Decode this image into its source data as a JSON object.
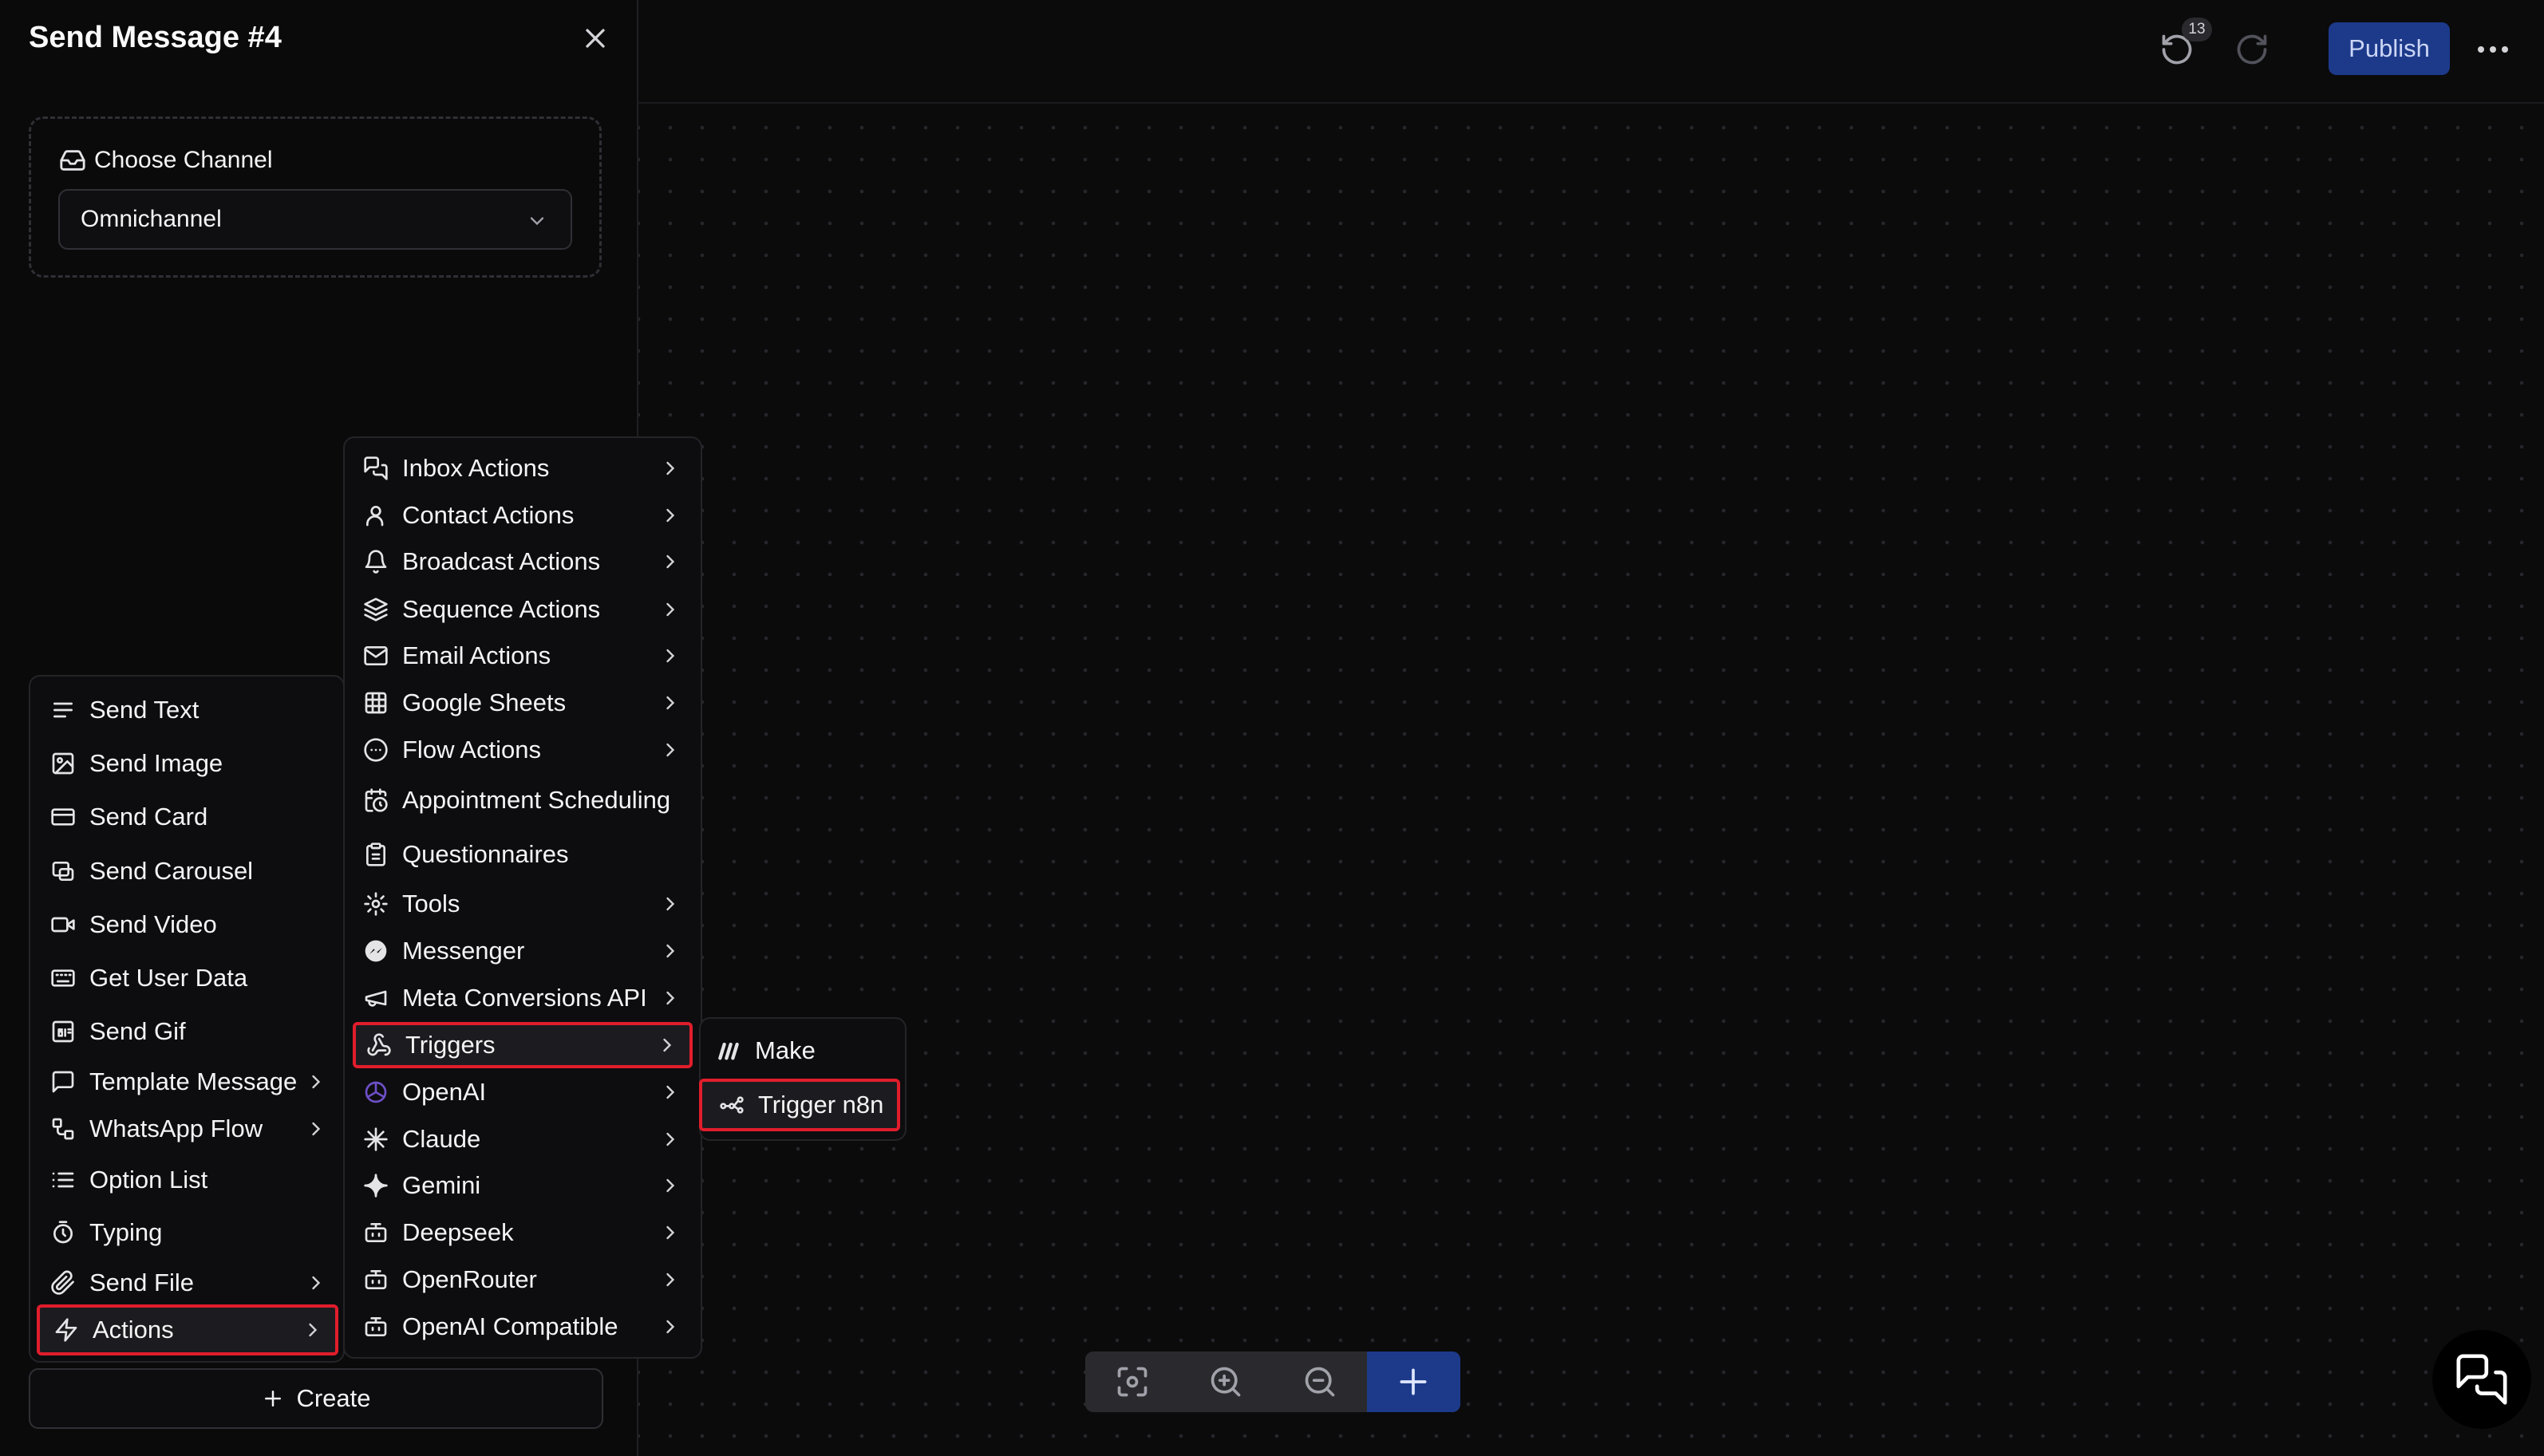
{
  "panel": {
    "title": "Send Message #4",
    "channel_label": "Choose Channel",
    "channel_value": "Omnichannel",
    "create_label": "Create"
  },
  "toolbar": {
    "undo_count": "13",
    "publish_label": "Publish"
  },
  "main_menu": [
    {
      "label": "Send Text",
      "icon": "text-lines-icon",
      "submenu": false
    },
    {
      "label": "Send Image",
      "icon": "image-icon",
      "submenu": false
    },
    {
      "label": "Send Card",
      "icon": "card-icon",
      "submenu": false
    },
    {
      "label": "Send Carousel",
      "icon": "carousel-icon",
      "submenu": false
    },
    {
      "label": "Send Video",
      "icon": "video-icon",
      "submenu": false
    },
    {
      "label": "Get User Data",
      "icon": "keyboard-icon",
      "submenu": false
    },
    {
      "label": "Send Gif",
      "icon": "gif-icon",
      "submenu": false
    },
    {
      "label": "Template Message",
      "icon": "message-square-icon",
      "submenu": true
    },
    {
      "label": "WhatsApp Flow",
      "icon": "flow-icon",
      "submenu": true
    },
    {
      "label": "Option List",
      "icon": "list-icon",
      "submenu": false
    },
    {
      "label": "Typing",
      "icon": "timer-icon",
      "submenu": false
    },
    {
      "label": "Send File",
      "icon": "paperclip-icon",
      "submenu": true
    },
    {
      "label": "Actions",
      "icon": "lightning-icon",
      "submenu": true,
      "highlighted": true
    }
  ],
  "actions_menu": [
    {
      "label": "Inbox Actions",
      "icon": "messages-icon",
      "submenu": true
    },
    {
      "label": "Contact Actions",
      "icon": "user-icon",
      "submenu": true
    },
    {
      "label": "Broadcast Actions",
      "icon": "bell-icon",
      "submenu": true
    },
    {
      "label": "Sequence Actions",
      "icon": "layers-icon",
      "submenu": true
    },
    {
      "label": "Email Actions",
      "icon": "mail-icon",
      "submenu": true
    },
    {
      "label": "Google Sheets",
      "icon": "sheet-icon",
      "submenu": true
    },
    {
      "label": "Flow Actions",
      "icon": "dots-circle-icon",
      "submenu": true
    },
    {
      "label": "Appointment Scheduling",
      "icon": "calendar-clock-icon",
      "submenu": false
    },
    {
      "label": "Questionnaires",
      "icon": "clipboard-icon",
      "submenu": false
    },
    {
      "label": "Tools",
      "icon": "cog-icon",
      "submenu": true
    },
    {
      "label": "Messenger",
      "icon": "messenger-icon",
      "submenu": true
    },
    {
      "label": "Meta Conversions API",
      "icon": "megaphone-icon",
      "submenu": true
    },
    {
      "label": "Triggers",
      "icon": "webhook-icon",
      "submenu": true,
      "highlighted": true
    },
    {
      "label": "OpenAI",
      "icon": "openai-icon",
      "submenu": true
    },
    {
      "label": "Claude",
      "icon": "claude-icon",
      "submenu": true
    },
    {
      "label": "Gemini",
      "icon": "gemini-icon",
      "submenu": true
    },
    {
      "label": "Deepseek",
      "icon": "bot-icon",
      "submenu": true
    },
    {
      "label": "OpenRouter",
      "icon": "bot-icon",
      "submenu": true
    },
    {
      "label": "OpenAI Compatible",
      "icon": "bot-icon",
      "submenu": true
    }
  ],
  "triggers_menu": [
    {
      "label": "Make",
      "icon": "make-icon"
    },
    {
      "label": "Trigger n8n",
      "icon": "n8n-icon",
      "highlighted": true
    }
  ],
  "colors": {
    "highlight": "#e11d2c",
    "accent": "#1d3a8a",
    "background": "#0a0a0b"
  }
}
